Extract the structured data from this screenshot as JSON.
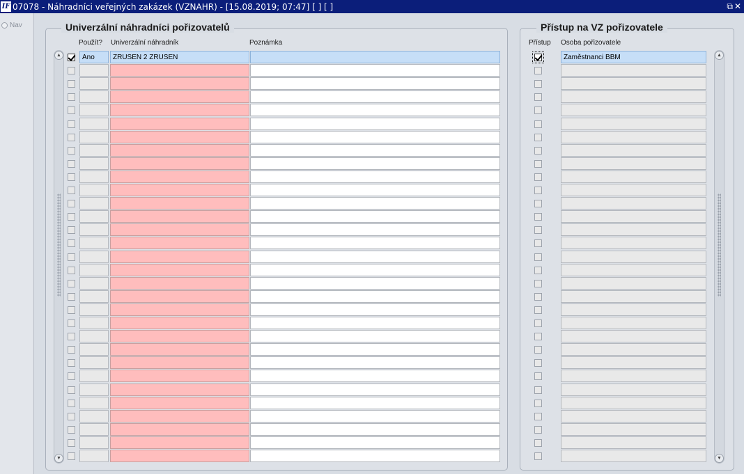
{
  "window": {
    "icon_label": "IF",
    "title": "07078 - Náhradníci veřejných zakázek (VZNAHR) - [15.08.2019; 07:47]  [ ]  [ ]",
    "restore_glyph": "⧉",
    "close_glyph": "✕"
  },
  "nav": {
    "label": "Nav"
  },
  "left_panel": {
    "title": "Univerzální náhradníci pořizovatelů",
    "columns": {
      "use": "Použít?",
      "substitute": "Univerzální náhradník",
      "note": "Poznámka"
    },
    "rows": [
      {
        "checked": true,
        "use": "Ano",
        "substitute": "ZRUSEN 2 ZRUSEN",
        "note": ""
      }
    ],
    "row_count": 31
  },
  "right_panel": {
    "title": "Přístup na VZ pořizovatele",
    "columns": {
      "access": "Přístup",
      "person": "Osoba pořizovatele"
    },
    "rows": [
      {
        "checked": true,
        "person": "Zaměstnanci BBM"
      }
    ],
    "row_count": 31
  },
  "scroll": {
    "up_glyph": "▲",
    "down_glyph": "▼"
  }
}
